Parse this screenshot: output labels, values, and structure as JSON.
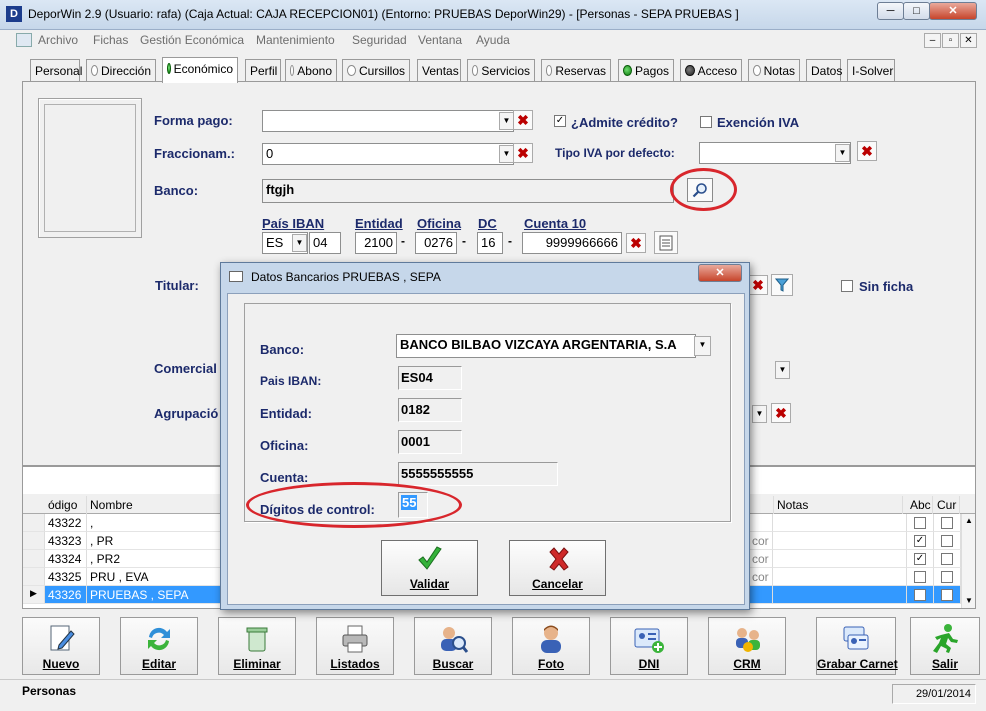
{
  "window": {
    "title": "DeporWin 2.9  (Usuario: rafa)  (Caja Actual: CAJA RECEPCION01) (Entorno: PRUEBAS DeporWin29) - [Personas - SEPA PRUEBAS ]",
    "icon_letter": "D",
    "controls": {
      "minimize": "─",
      "maximize": "□",
      "close": "✕"
    }
  },
  "menu": [
    "Archivo",
    "Fichas",
    "Gestión Económica",
    "Mantenimiento",
    "Seguridad",
    "Ventana",
    "Ayuda"
  ],
  "tabs": [
    {
      "label": "Personal"
    },
    {
      "label": "Dirección"
    },
    {
      "label": "Económico"
    },
    {
      "label": "Perfil"
    },
    {
      "label": "Abono"
    },
    {
      "label": "Cursillos"
    },
    {
      "label": "Ventas"
    },
    {
      "label": "Servicios"
    },
    {
      "label": "Reservas"
    },
    {
      "label": "Pagos"
    },
    {
      "label": "Acceso"
    },
    {
      "label": "Notas"
    },
    {
      "label": "Datos"
    },
    {
      "label": "I-Solver"
    }
  ],
  "form": {
    "forma_pago_label": "Forma pago:",
    "forma_pago_value": "",
    "fraccionam_label": "Fraccionam.:",
    "fraccionam_value": "0",
    "admite_credito_label": "¿Admite crédito?",
    "admite_credito_checked": true,
    "exencion_iva_label": "Exención IVA",
    "exencion_iva_checked": false,
    "tipo_iva_label": "Tipo IVA por defecto:",
    "tipo_iva_value": "",
    "banco_label": "Banco:",
    "banco_value": "ftgjh",
    "iban_headers": {
      "pais": "País IBAN",
      "entidad": "Entidad",
      "oficina": "Oficina",
      "dc": "DC",
      "cuenta": "Cuenta 10"
    },
    "iban_values": {
      "pais": "ES",
      "iban_dc": "04",
      "entidad": "2100",
      "oficina": "0276",
      "dc": "16",
      "cuenta": "9999966666"
    },
    "titular_label": "Titular:",
    "sin_ficha_label": "Sin ficha",
    "sin_ficha_checked": false,
    "comercial_label": "Comercial",
    "agrupacion_label": "Agrupació"
  },
  "grid": {
    "headers": [
      "ódigo",
      "Nombre",
      "Notas",
      "Abc",
      "Cur"
    ],
    "rows": [
      {
        "code": "43322",
        "name": ",",
        "mid": "",
        "abc": false,
        "cur": false
      },
      {
        "code": "43323",
        "name": ", PR",
        "mid": "cor",
        "abc": true,
        "cur": false
      },
      {
        "code": "43324",
        "name": ", PR2",
        "mid": "cor",
        "abc": true,
        "cur": false
      },
      {
        "code": "43325",
        "name": "PRU , EVA",
        "mid": "cor",
        "abc": false,
        "cur": false
      },
      {
        "code": "43326",
        "name": "PRUEBAS , SEPA",
        "mid": "",
        "abc": false,
        "cur": false
      }
    ],
    "selected_index": 4
  },
  "toolbar": [
    "Nuevo",
    "Editar",
    "Eliminar",
    "Listados",
    "Buscar",
    "Foto",
    "DNI",
    "CRM",
    "Grabar Carnet",
    "Salir"
  ],
  "status": {
    "text": "Personas",
    "date": "29/01/2014"
  },
  "dialog": {
    "title": "Datos Bancarios PRUEBAS , SEPA",
    "close": "✕",
    "banco_label": "Banco:",
    "banco_value": "BANCO BILBAO VIZCAYA ARGENTARIA, S.A",
    "pais_iban_label": "Pais IBAN:",
    "pais_iban_value": "ES04",
    "entidad_label": "Entidad:",
    "entidad_value": "0182",
    "oficina_label": "Oficina:",
    "oficina_value": "0001",
    "cuenta_label": "Cuenta:",
    "cuenta_value": "5555555555",
    "digitos_label": "Dígitos de control:",
    "digitos_value": "55",
    "validar_label": "Validar",
    "cancelar_label": "Cancelar"
  },
  "colors": {
    "highlight_oval": "#d8262c",
    "selection": "#3399ff",
    "label": "#1c2a6b"
  }
}
